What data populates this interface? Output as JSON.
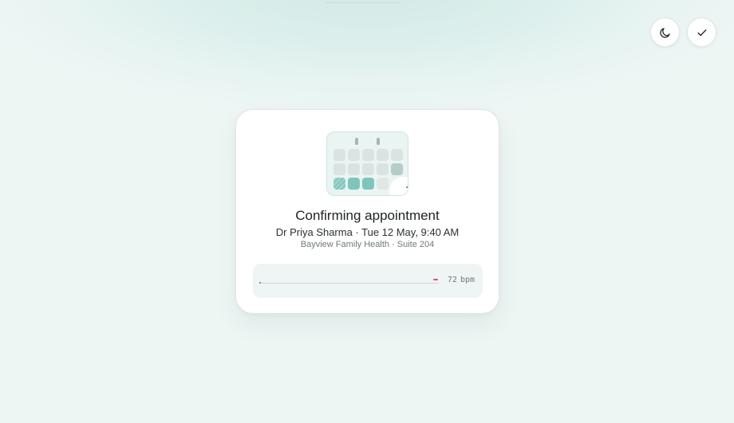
{
  "toolbar": {
    "theme_icon": "moon-icon",
    "confirm_icon": "check-icon"
  },
  "appointment": {
    "status_title": "Confirming appointment",
    "details": "Dr Priya Sharma · Tue 12 May, 9:40 AM",
    "location": "Bayview Family Health · Suite 204"
  },
  "vitals": {
    "heart_rate_value": "72",
    "heart_rate_unit": "bpm"
  },
  "colors": {
    "accent_teal": "#7ec5bc",
    "marker_red": "#e0506a",
    "background": "#eef6f4"
  }
}
